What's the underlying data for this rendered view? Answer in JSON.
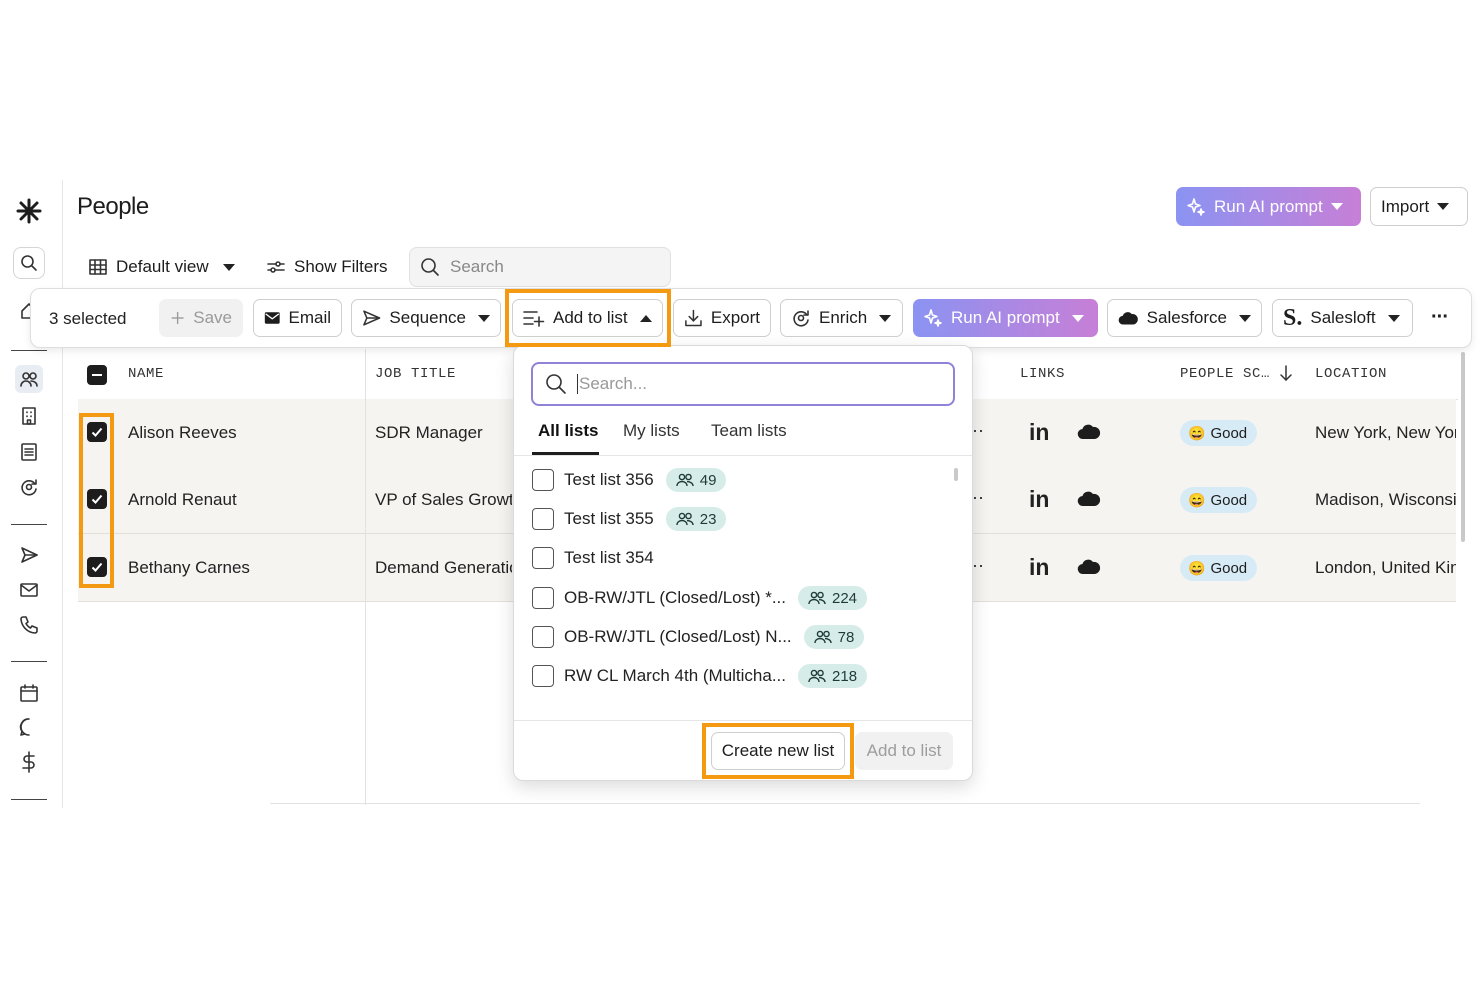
{
  "page": {
    "title": "People"
  },
  "header": {
    "run_ai_label": "Run AI prompt",
    "import_label": "Import"
  },
  "viewbar": {
    "view_label": "Default view",
    "filters_label": "Show Filters",
    "search_placeholder": "Search"
  },
  "toolbar": {
    "selected_count": "3 selected",
    "save": "Save",
    "email": "Email",
    "sequence": "Sequence",
    "add_to_list": "Add to list",
    "export": "Export",
    "enrich": "Enrich",
    "run_ai": "Run AI prompt",
    "salesforce": "Salesforce",
    "salesloft": "Salesloft",
    "more": "···"
  },
  "table": {
    "columns": {
      "name": "NAME",
      "job_title": "JOB TITLE",
      "links": "LINKS",
      "people_score": "PEOPLE SC…",
      "location": "LOCATION"
    },
    "rows": [
      {
        "name": "Alison Reeves",
        "job_title": "SDR Manager",
        "score": "Good",
        "location": "New York, New York",
        "selected": true
      },
      {
        "name": "Arnold Renaut",
        "job_title": "VP of Sales Growth",
        "score": "Good",
        "location": "Madison, Wisconsin",
        "selected": true
      },
      {
        "name": "Bethany Carnes",
        "job_title": "Demand Generation",
        "score": "Good",
        "location": "London, United Kingdom",
        "selected": true
      }
    ]
  },
  "dropdown": {
    "search_placeholder": "Search...",
    "tabs": [
      "All lists",
      "My lists",
      "Team lists"
    ],
    "active_tab": "All lists",
    "items": [
      {
        "label": "Test list 356",
        "count": "49"
      },
      {
        "label": "Test list 355",
        "count": "23"
      },
      {
        "label": "Test list 354",
        "count": ""
      },
      {
        "label": "OB-RW/JTL (Closed/Lost) *...",
        "count": "224"
      },
      {
        "label": "OB-RW/JTL (Closed/Lost) N...",
        "count": "78"
      },
      {
        "label": "RW CL March 4th (Multicha...",
        "count": "218"
      }
    ],
    "create_label": "Create new list",
    "add_label": "Add to list"
  },
  "colors": {
    "accent_highlight": "#f39a12",
    "ai_gradient_start": "#8b93f2",
    "ai_gradient_end": "#c77fd6",
    "good_badge": "#d7ebf7",
    "count_badge": "#d6ece8"
  }
}
